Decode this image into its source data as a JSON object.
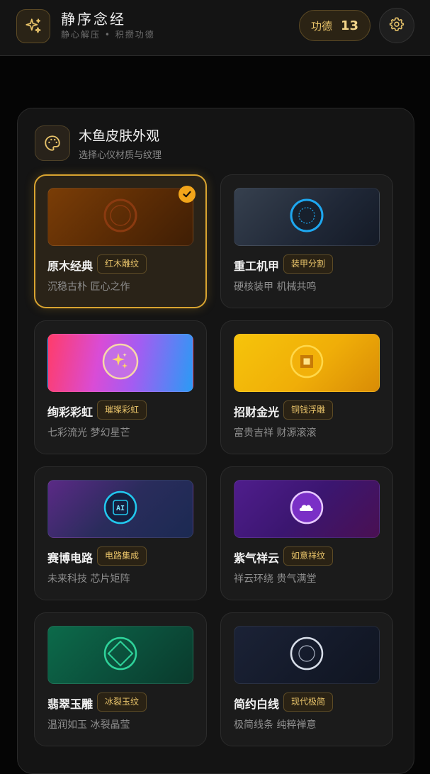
{
  "header": {
    "title": "静序念经",
    "subtitle": "静心解压 • 积攒功德",
    "merit_label": "功德",
    "merit_count": "13",
    "logo_icon": "sparkles-icon",
    "settings_icon": "gear-icon"
  },
  "panel": {
    "icon": "palette-icon",
    "title": "木鱼皮肤外观",
    "subtitle": "选择心仪材质与纹理"
  },
  "skins": [
    {
      "name": "原木经典",
      "tag": "红木雕纹",
      "desc": "沉稳古朴 匠心之作",
      "selected": true,
      "icon": "wood-ring-icon"
    },
    {
      "name": "重工机甲",
      "tag": "装甲分割",
      "desc": "硬核装甲 机械共鸣",
      "selected": false,
      "icon": "mecha-ring-icon"
    },
    {
      "name": "绚彩彩虹",
      "tag": "璀璨彩虹",
      "desc": "七彩流光 梦幻星芒",
      "selected": false,
      "icon": "sparkle-icon"
    },
    {
      "name": "招财金光",
      "tag": "铜钱浮雕",
      "desc": "富贵吉祥 财源滚滚",
      "selected": false,
      "icon": "coin-icon"
    },
    {
      "name": "赛博电路",
      "tag": "电路集成",
      "desc": "未来科技 芯片矩阵",
      "selected": false,
      "icon": "ai-chip-icon",
      "icon_text": "AI"
    },
    {
      "name": "紫气祥云",
      "tag": "如意祥纹",
      "desc": "祥云环绕 贵气满堂",
      "selected": false,
      "icon": "cloud-icon"
    },
    {
      "name": "翡翠玉雕",
      "tag": "冰裂玉纹",
      "desc": "温润如玉 冰裂晶莹",
      "selected": false,
      "icon": "jade-diamond-icon"
    },
    {
      "name": "简约白线",
      "tag": "现代极简",
      "desc": "极简线条 纯粹禅意",
      "selected": false,
      "icon": "minimal-ring-icon"
    }
  ],
  "colors": {
    "accent": "#d9a430",
    "check": "#f2a51a",
    "tag_text": "#e9c46a"
  }
}
